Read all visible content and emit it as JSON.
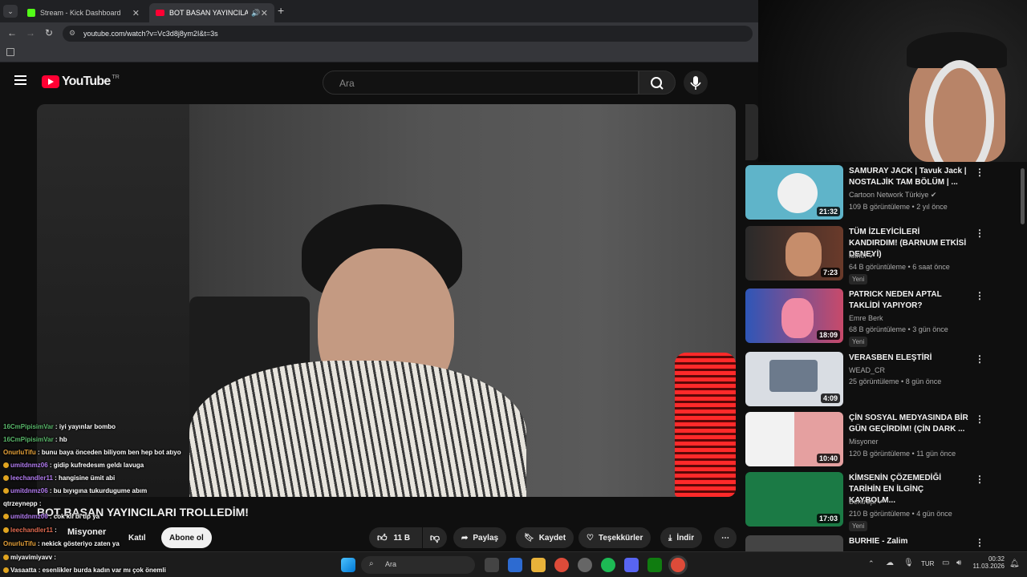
{
  "browser": {
    "tabs": [
      {
        "label": "Stream - Kick Dashboard",
        "active": false
      },
      {
        "label": "BOT BASAN YAYINCILARI TROLLEDİM!",
        "active": true
      }
    ],
    "url": "youtube.com/watch?v=Vc3d8j8ym2I&t=3s"
  },
  "youtube": {
    "logo": "YouTube",
    "region": "TR",
    "search_placeholder": "Ara"
  },
  "video": {
    "title": "BOT BASAN YAYINCILARI TROLLEDİM!",
    "channel": "Misyoner",
    "join_label": "Katıl",
    "subscribe_label": "Abone ol",
    "likes": "11 B",
    "share_label": "Paylaş",
    "save_label": "Kaydet",
    "thanks_label": "Teşekkürler",
    "download_label": "İndir"
  },
  "chat": [
    {
      "user": "16CmPipisimVar",
      "msg": "iyi yayınlar bombo",
      "color": "green",
      "badge": false
    },
    {
      "user": "16CmPipisimVar",
      "msg": "hb",
      "color": "green",
      "badge": false
    },
    {
      "user": "OnurluTifu",
      "msg": "bunu baya önceden biliyom ben hep bot atıyo",
      "color": "orange",
      "badge": false
    },
    {
      "user": "umitdnmz06",
      "msg": "gidip kufredesım geldı lavuga",
      "color": "purple",
      "badge": true
    },
    {
      "user": "leechandler11",
      "msg": "hangisine ümit abi",
      "color": "purple",
      "badge": true
    },
    {
      "user": "umitdnmz06",
      "msg": "bu bıyıgına tukurdugume abım",
      "color": "purple",
      "badge": true
    },
    {
      "user": "qtrzeynepp",
      "msg": "",
      "color": "white",
      "badge": false
    },
    {
      "user": "umitdnmz06",
      "msg": "cok kıl bi tip ya",
      "color": "purple",
      "badge": true
    },
    {
      "user": "leechandler11",
      "msg": "",
      "color": "red",
      "badge": true
    },
    {
      "user": "OnurluTifu",
      "msg": "nekick gösteriyo zaten ya",
      "color": "orange",
      "badge": false
    },
    {
      "user": "miyavimiyavv",
      "msg": "",
      "color": "white",
      "badge": true
    },
    {
      "user": "Vasaatta",
      "msg": "esenlikler burda kadın var mı çok önemli",
      "color": "white",
      "badge": true
    }
  ],
  "recommendations": [
    {
      "title": "SAMURAY JACK | Tavuk Jack | NOSTALJİK TAM BÖLÜM | ...",
      "channel": "Cartoon Network Türkiye",
      "verified": true,
      "meta": "109 B görüntüleme • 2 yıl önce",
      "duration": "21:32",
      "new": false,
      "thumb_color": "#5fb4c9"
    },
    {
      "title": "TÜM İZLEYİCİLERİ KANDIRDIM! (BARNUM ETKİSİ DENEYİ)",
      "channel": "luther",
      "verified": true,
      "meta": "64 B görüntüleme • 6 saat önce",
      "duration": "7:23",
      "new": true,
      "new_label": "Yeni",
      "thumb_color": "#4a2a2a"
    },
    {
      "title": "PATRICK NEDEN APTAL TAKLİDİ YAPIYOR?",
      "channel": "Emre Berk",
      "verified": false,
      "meta": "68 B görüntüleme • 3 gün önce",
      "duration": "18:09",
      "new": true,
      "new_label": "Yeni",
      "thumb_color": "#3a5fc0"
    },
    {
      "title": "VERASBEN ELEŞTİRİ",
      "channel": "WEAD_CR",
      "verified": false,
      "meta": "25 görüntüleme • 8 gün önce",
      "duration": "4:09",
      "new": false,
      "thumb_color": "#d9dde3"
    },
    {
      "title": "ÇİN SOSYAL MEDYASINDA BİR GÜN GEÇİRDİM! (ÇİN DARK ...",
      "channel": "Misyoner",
      "verified": false,
      "meta": "120 B görüntüleme • 11 gün önce",
      "duration": "10:40",
      "new": false,
      "thumb_color": "#e5c7c0"
    },
    {
      "title": "KİMSENİN ÇÖZEMEDİĞİ TARİHİN EN İLGİNÇ KAYBOLM...",
      "channel": "Bentropi",
      "verified": true,
      "meta": "210 B görüntüleme • 4 gün önce",
      "duration": "17:03",
      "new": true,
      "new_label": "Yeni",
      "thumb_color": "#1b7a45"
    },
    {
      "title": "BURHIE - Zalim",
      "channel": "",
      "verified": false,
      "meta": "",
      "duration": "",
      "new": false,
      "thumb_color": "#444"
    }
  ],
  "taskbar": {
    "search_label": "Ara",
    "lang": "TUR",
    "time": "00:32",
    "date": "11.03.2026"
  }
}
